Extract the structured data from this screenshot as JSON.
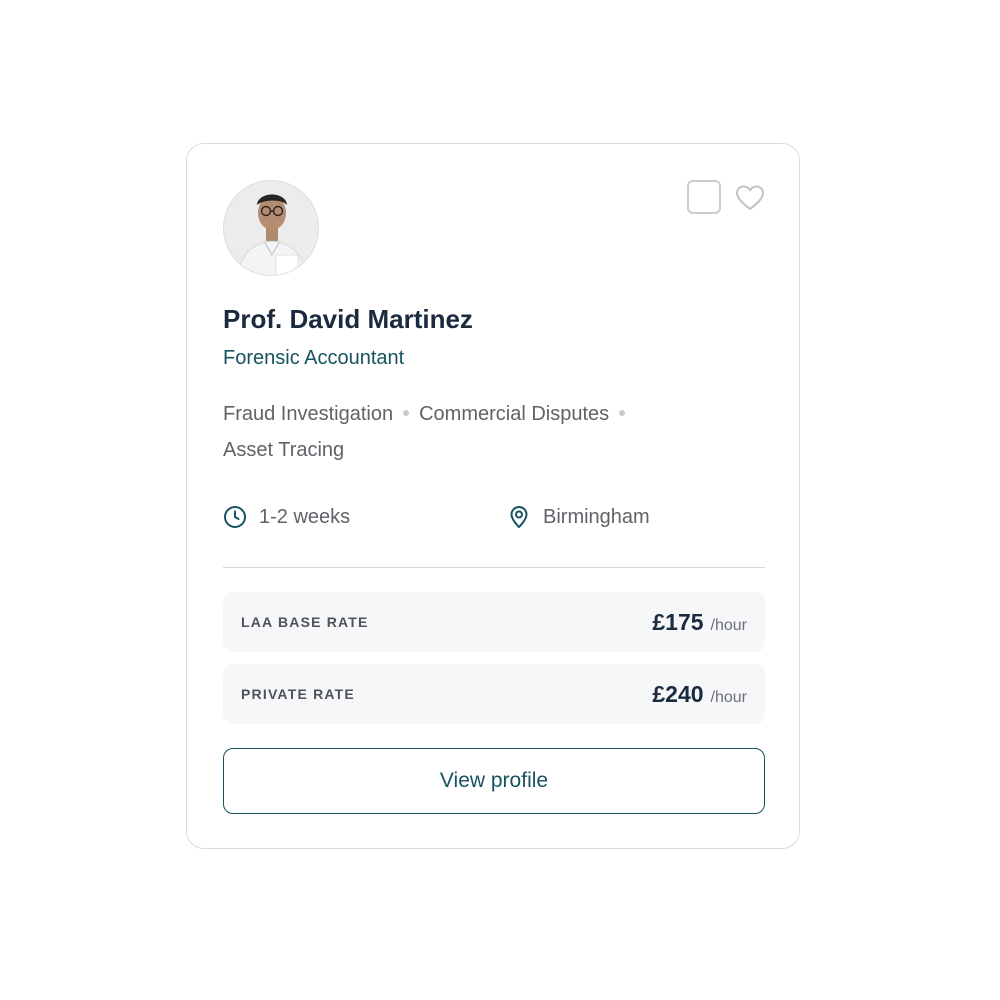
{
  "profile": {
    "name": "Prof. David Martinez",
    "role": "Forensic Accountant",
    "specialties": [
      "Fraud Investigation",
      "Commercial Disputes",
      "Asset Tracing"
    ],
    "turnaround": "1-2 weeks",
    "location": "Birmingham",
    "avatar_icon": "person-photo",
    "select_icon": "checkbox-icon",
    "favorite_icon": "heart-icon",
    "clock_icon": "clock-icon",
    "location_icon": "map-pin-icon"
  },
  "rates": [
    {
      "label": "LAA BASE RATE",
      "amount": "£175",
      "unit": "/hour"
    },
    {
      "label": "PRIVATE RATE",
      "amount": "£240",
      "unit": "/hour"
    }
  ],
  "actions": {
    "view_profile_label": "View profile"
  },
  "colors": {
    "accent": "#16535e",
    "name_text": "#1b2a3e",
    "muted_text": "#5f6368",
    "rate_bg": "#f6f7f9",
    "border": "#d8dbe0"
  }
}
